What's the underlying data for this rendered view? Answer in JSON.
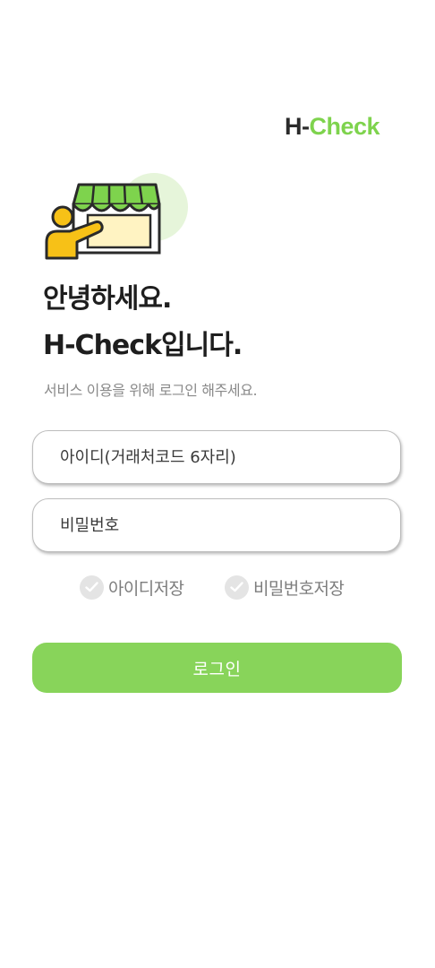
{
  "brand": {
    "logo_prefix": "H-",
    "logo_suffix": "Check",
    "accent_color": "#7ed34d",
    "button_color": "#88d45a"
  },
  "greeting": {
    "line1": "안녕하세요.",
    "line2": "H-Check입니다.",
    "subtitle": "서비스 이용을 위해 로그인 해주세요."
  },
  "form": {
    "id_placeholder": "아이디(거래처코드 6자리)",
    "id_value": "",
    "password_placeholder": "비밀번호",
    "password_value": "",
    "save_id_label": "아이디저장",
    "save_password_label": "비밀번호저장",
    "save_id_checked": false,
    "save_password_checked": false,
    "login_label": "로그인"
  },
  "icons": {
    "checkbox": "check-icon",
    "illustration": "store-clerk-illustration"
  }
}
